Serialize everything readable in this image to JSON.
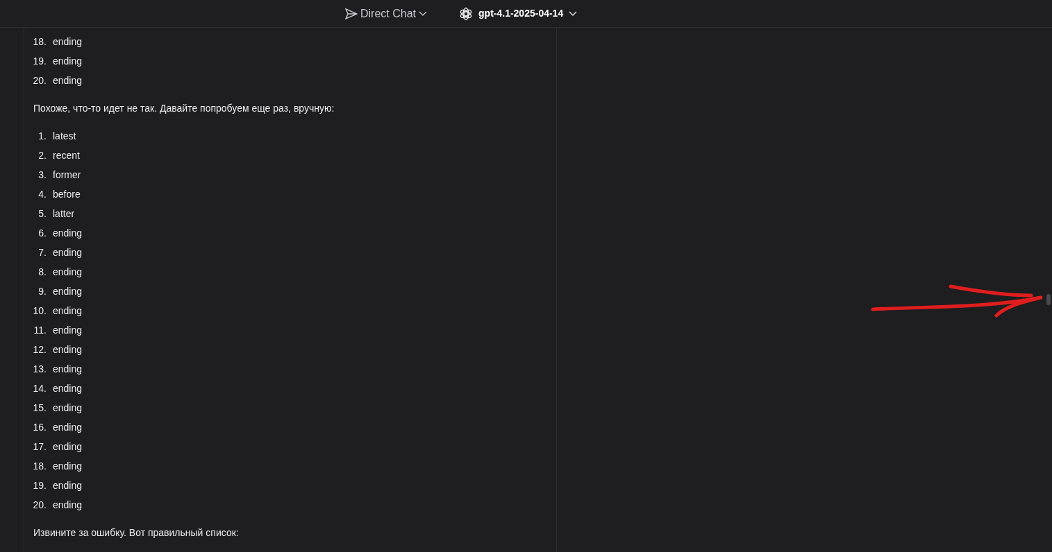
{
  "header": {
    "chat_mode": "Direct Chat",
    "model": "gpt-4.1-2025-04-14"
  },
  "messages": [
    {
      "kind": "list",
      "items": [
        {
          "number": "18.",
          "text": "ending"
        },
        {
          "number": "19.",
          "text": "ending"
        },
        {
          "number": "20.",
          "text": "ending"
        }
      ]
    },
    {
      "kind": "paragraph",
      "text": "Похоже, что-то идет не так. Давайте попробуем еще раз, вручную:"
    },
    {
      "kind": "list",
      "items": [
        {
          "number": "1.",
          "text": "latest"
        },
        {
          "number": "2.",
          "text": "recent"
        },
        {
          "number": "3.",
          "text": "former"
        },
        {
          "number": "4.",
          "text": "before"
        },
        {
          "number": "5.",
          "text": "latter"
        },
        {
          "number": "6.",
          "text": "ending"
        },
        {
          "number": "7.",
          "text": "ending"
        },
        {
          "number": "8.",
          "text": "ending"
        },
        {
          "number": "9.",
          "text": "ending"
        },
        {
          "number": "10.",
          "text": "ending"
        },
        {
          "number": "11.",
          "text": "ending"
        },
        {
          "number": "12.",
          "text": "ending"
        },
        {
          "number": "13.",
          "text": "ending"
        },
        {
          "number": "14.",
          "text": "ending"
        },
        {
          "number": "15.",
          "text": "ending"
        },
        {
          "number": "16.",
          "text": "ending"
        },
        {
          "number": "17.",
          "text": "ending"
        },
        {
          "number": "18.",
          "text": "ending"
        },
        {
          "number": "19.",
          "text": "ending"
        },
        {
          "number": "20.",
          "text": "ending"
        }
      ]
    },
    {
      "kind": "paragraph",
      "text": "Извините за ошибку. Вот правильный список:"
    }
  ]
}
